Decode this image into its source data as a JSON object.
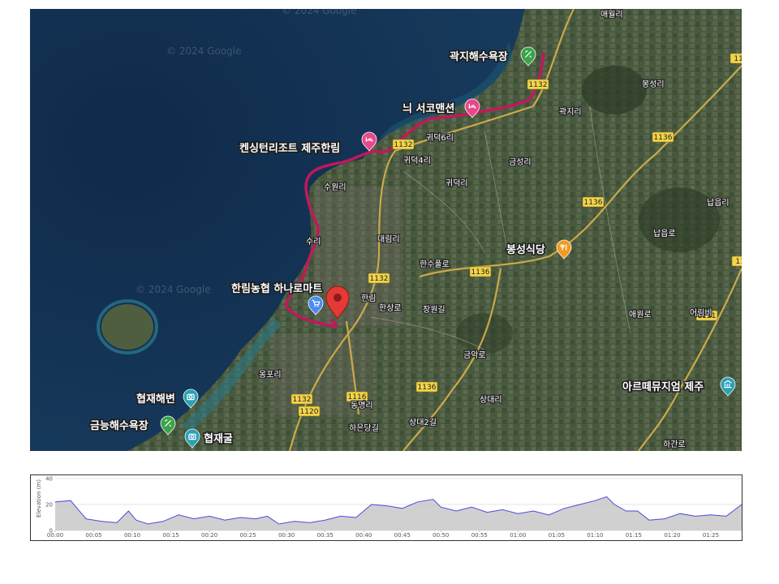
{
  "map": {
    "watermarks": [
      "© 2024 Google",
      "© 2024 Google",
      "© 2024 Google"
    ],
    "pois": [
      {
        "label": "곽지해수욕장",
        "icon": "beach-icon",
        "color": "#3aa34a"
      },
      {
        "label": "늬 서코맨션",
        "icon": "lodging-icon",
        "color": "#e8488a"
      },
      {
        "label": "켄싱턴리조트 제주한림",
        "icon": "lodging-icon",
        "color": "#e8488a"
      },
      {
        "label": "봉성식당",
        "icon": "restaurant-icon",
        "color": "#f29a1f"
      },
      {
        "label": "한림농협 하나로마트",
        "icon": "shopping-cart-icon",
        "color": "#4a8cf0"
      },
      {
        "label": "아르떼뮤지엄 제주",
        "icon": "museum-icon",
        "color": "#2aa1b5"
      },
      {
        "label": "협재해변",
        "icon": "camera-icon",
        "color": "#2aa1b5"
      },
      {
        "label": "금능해수욕장",
        "icon": "beach-icon",
        "color": "#3aa34a"
      },
      {
        "label": "협재굴",
        "icon": "camera-icon",
        "color": "#2aa1b5"
      }
    ],
    "areas": [
      "애월리",
      "곽지리",
      "귀덕6리",
      "귀덕4리",
      "귀덕리",
      "금성리",
      "수원리",
      "대림리",
      "수리",
      "한림",
      "한상로",
      "한수풀로",
      "장원길",
      "금악로",
      "옹포리",
      "동명리",
      "하은당길",
      "상대리",
      "상대2길",
      "납읍리",
      "어림비",
      "납읍로",
      "봉성리",
      "애원로",
      "하간로"
    ],
    "roads": [
      "1132",
      "1132",
      "1136",
      "1136",
      "1136",
      "1136",
      "1132",
      "1116",
      "1132",
      "1120",
      "1121",
      "113",
      "113"
    ],
    "route": {
      "color": "#c2185b"
    },
    "marker_color": "#e53935"
  },
  "elevation": {
    "ylabel": "Elevation (m)",
    "yticks": [
      "40",
      "20",
      "0"
    ],
    "xticks": [
      "00:00",
      "00:05",
      "00:10",
      "00:15",
      "00:20",
      "00:25",
      "00:30",
      "00:35",
      "00:40",
      "00:45",
      "00:50",
      "00:55",
      "01:00",
      "01:05",
      "01:10",
      "01:15",
      "01:20",
      "01:25"
    ],
    "ylim": [
      0,
      40
    ],
    "series": [
      {
        "time_min": 0,
        "elev_m": 22
      },
      {
        "time_min": 2,
        "elev_m": 23
      },
      {
        "time_min": 3,
        "elev_m": 16
      },
      {
        "time_min": 4,
        "elev_m": 9
      },
      {
        "time_min": 6,
        "elev_m": 7
      },
      {
        "time_min": 8,
        "elev_m": 6
      },
      {
        "time_min": 9.5,
        "elev_m": 15
      },
      {
        "time_min": 10.5,
        "elev_m": 8
      },
      {
        "time_min": 12,
        "elev_m": 5
      },
      {
        "time_min": 14,
        "elev_m": 7
      },
      {
        "time_min": 16,
        "elev_m": 12
      },
      {
        "time_min": 18,
        "elev_m": 9
      },
      {
        "time_min": 20,
        "elev_m": 11
      },
      {
        "time_min": 22,
        "elev_m": 8
      },
      {
        "time_min": 24,
        "elev_m": 10
      },
      {
        "time_min": 26,
        "elev_m": 9
      },
      {
        "time_min": 27.5,
        "elev_m": 11
      },
      {
        "time_min": 29,
        "elev_m": 5
      },
      {
        "time_min": 31,
        "elev_m": 7
      },
      {
        "time_min": 33,
        "elev_m": 6
      },
      {
        "time_min": 35,
        "elev_m": 8
      },
      {
        "time_min": 37,
        "elev_m": 11
      },
      {
        "time_min": 39,
        "elev_m": 10
      },
      {
        "time_min": 41,
        "elev_m": 20
      },
      {
        "time_min": 43,
        "elev_m": 19
      },
      {
        "time_min": 45,
        "elev_m": 17
      },
      {
        "time_min": 47,
        "elev_m": 22
      },
      {
        "time_min": 49,
        "elev_m": 24
      },
      {
        "time_min": 50,
        "elev_m": 18
      },
      {
        "time_min": 52,
        "elev_m": 15
      },
      {
        "time_min": 54,
        "elev_m": 18
      },
      {
        "time_min": 56,
        "elev_m": 14
      },
      {
        "time_min": 58,
        "elev_m": 16
      },
      {
        "time_min": 60,
        "elev_m": 13
      },
      {
        "time_min": 62,
        "elev_m": 15
      },
      {
        "time_min": 64,
        "elev_m": 12
      },
      {
        "time_min": 66,
        "elev_m": 17
      },
      {
        "time_min": 68,
        "elev_m": 20
      },
      {
        "time_min": 70,
        "elev_m": 23
      },
      {
        "time_min": 71.5,
        "elev_m": 26
      },
      {
        "time_min": 72.5,
        "elev_m": 20
      },
      {
        "time_min": 74,
        "elev_m": 15
      },
      {
        "time_min": 75.5,
        "elev_m": 15
      },
      {
        "time_min": 77,
        "elev_m": 8
      },
      {
        "time_min": 79,
        "elev_m": 9
      },
      {
        "time_min": 81,
        "elev_m": 13
      },
      {
        "time_min": 83,
        "elev_m": 11
      },
      {
        "time_min": 85,
        "elev_m": 12
      },
      {
        "time_min": 87,
        "elev_m": 11
      },
      {
        "time_min": 89,
        "elev_m": 20
      }
    ]
  }
}
